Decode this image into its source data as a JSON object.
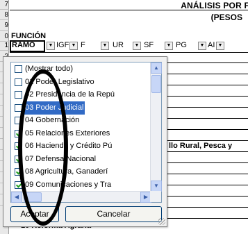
{
  "sheet": {
    "title_line1": "ANÁLISIS POR F",
    "title_line2": "(PESOS",
    "funcion_label": "FUNCIÓN",
    "ramo_label": "RAMO",
    "columns": [
      "IGF",
      "F",
      "UR",
      "SF",
      "PG",
      "AI"
    ],
    "row_numbers": [
      "7",
      "8",
      "9",
      "0",
      "1",
      "2",
      "3",
      "4",
      "5",
      "6",
      "7",
      "8",
      "9",
      "0",
      "1",
      "2",
      "3",
      "4",
      "5"
    ],
    "visible_cell_text": "llo Rural, Pesca y",
    "bottom_cell_text": "10 Reforma Agraria"
  },
  "filter_popup": {
    "items": [
      {
        "label": "(Mostrar todo)",
        "checked": false,
        "selected": false
      },
      {
        "label": "01 Poder Legislativo",
        "checked": false,
        "selected": false
      },
      {
        "label": "02 Presidencia de la Repú",
        "checked": false,
        "selected": false
      },
      {
        "label": "03 Poder Judicial",
        "checked": false,
        "selected": true
      },
      {
        "label": "04 Gobernación",
        "checked": false,
        "selected": false
      },
      {
        "label": "05 Relaciones Exteriores",
        "checked": true,
        "selected": false
      },
      {
        "label": "06 Hacienda y Crédito Pú",
        "checked": true,
        "selected": false
      },
      {
        "label": "07 Defensa Nacional",
        "checked": true,
        "selected": false
      },
      {
        "label": "08 Agricultura, Ganaderí",
        "checked": true,
        "selected": false
      },
      {
        "label": "09 Comunicaciones y Tra",
        "checked": true,
        "selected": false
      }
    ],
    "ok_label": "Aceptar",
    "cancel_label": "Cancelar"
  }
}
